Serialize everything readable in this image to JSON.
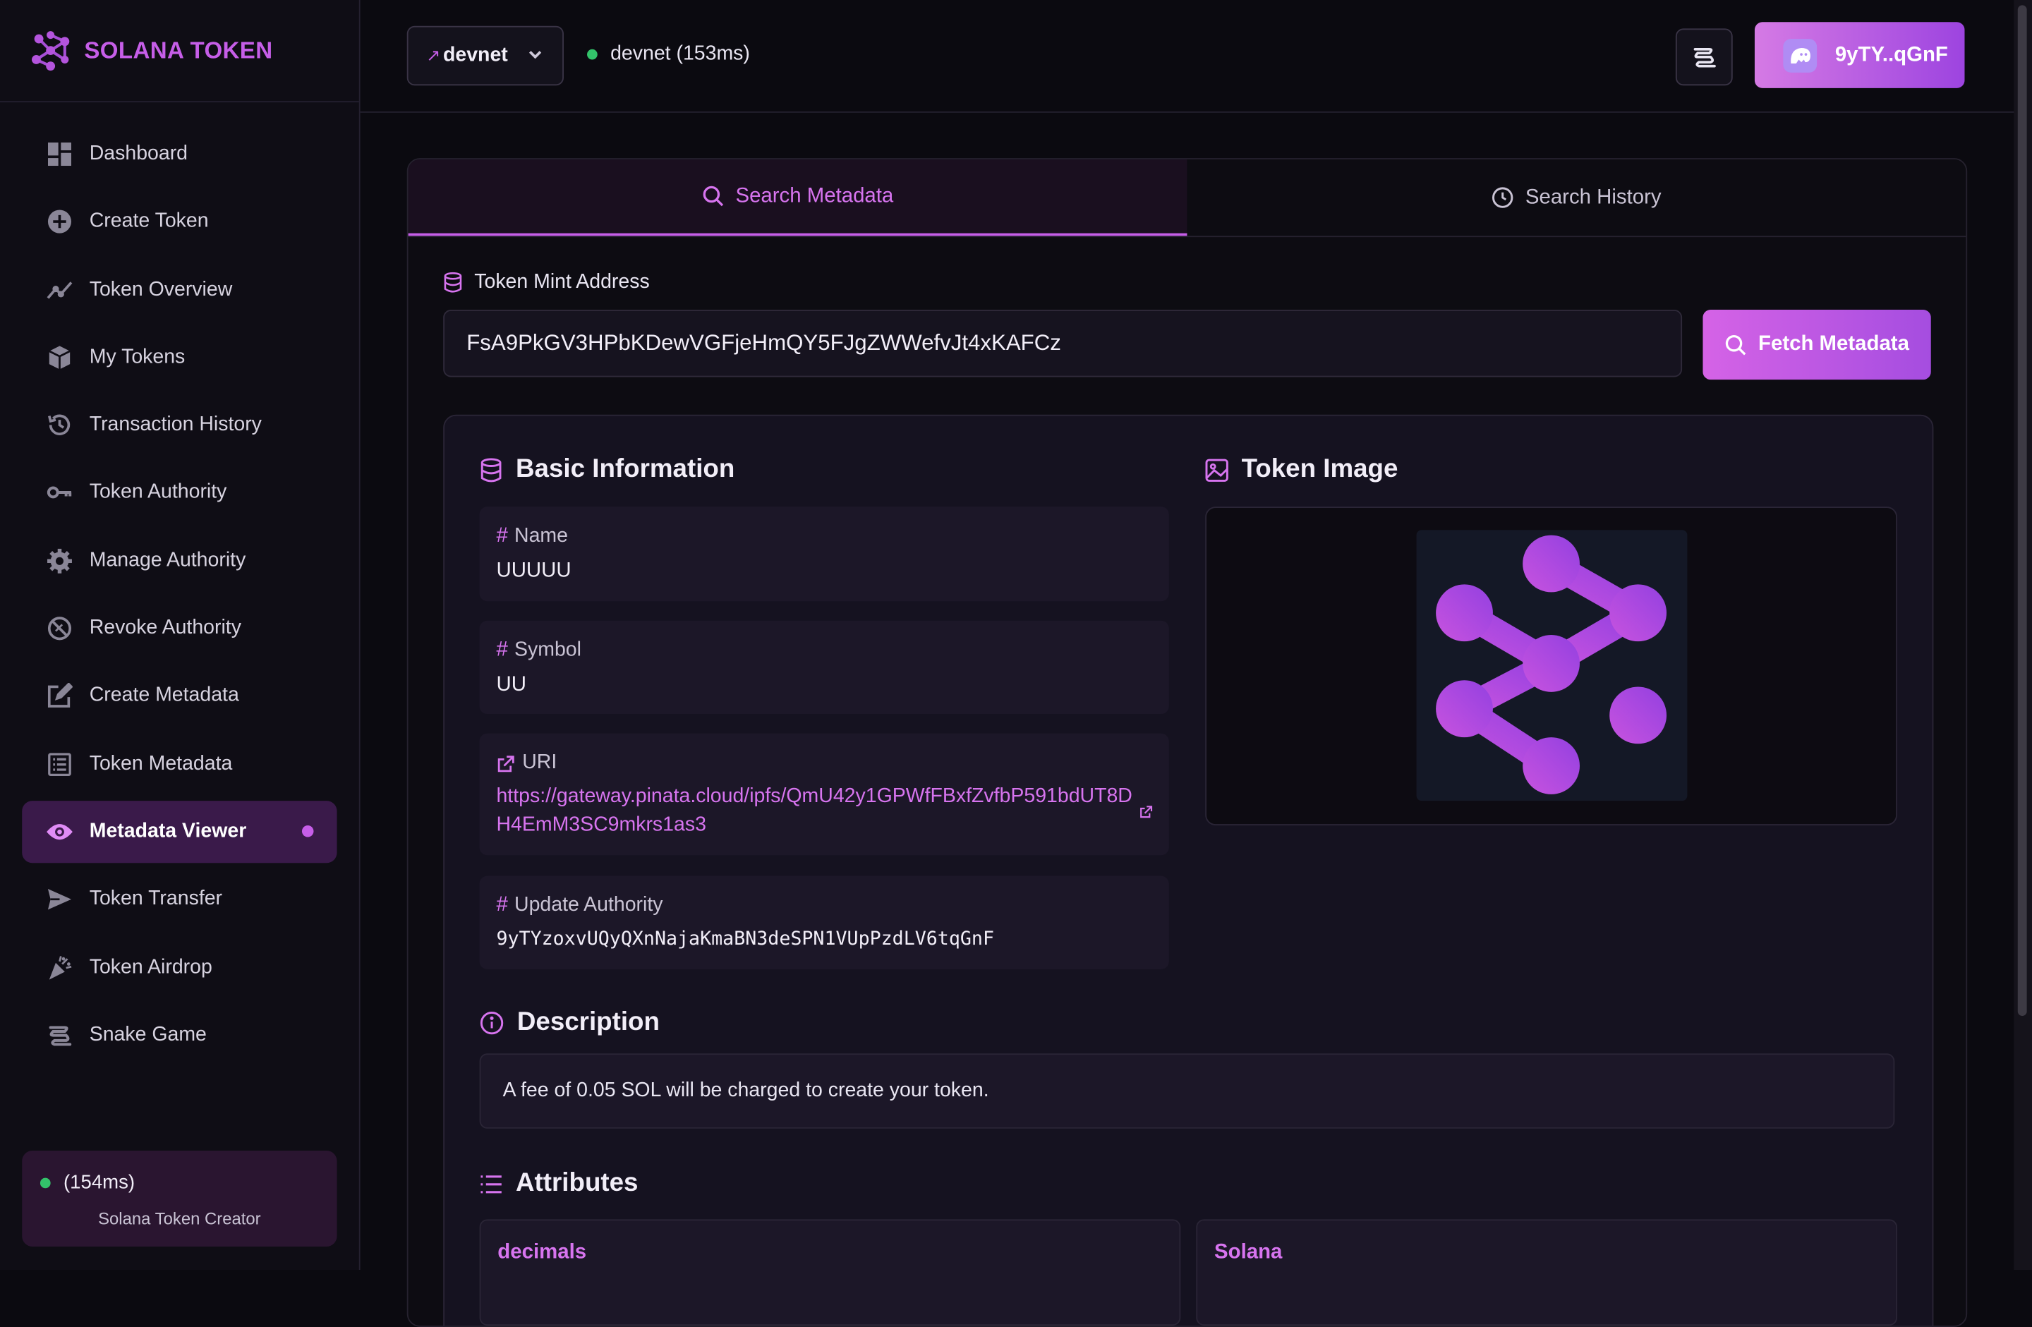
{
  "brand": {
    "name": "SOLANA TOKEN"
  },
  "sidebar": {
    "items": [
      {
        "label": "Dashboard",
        "icon": "dashboard-icon"
      },
      {
        "label": "Create Token",
        "icon": "plus-circle-icon"
      },
      {
        "label": "Token Overview",
        "icon": "trend-chart-icon"
      },
      {
        "label": "My Tokens",
        "icon": "cube-icon"
      },
      {
        "label": "Transaction History",
        "icon": "history-icon"
      },
      {
        "label": "Token Authority",
        "icon": "key-icon"
      },
      {
        "label": "Manage Authority",
        "icon": "gear-icon"
      },
      {
        "label": "Revoke Authority",
        "icon": "block-icon"
      },
      {
        "label": "Create Metadata",
        "icon": "edit-icon"
      },
      {
        "label": "Token Metadata",
        "icon": "list-doc-icon"
      },
      {
        "label": "Metadata Viewer",
        "icon": "eye-icon",
        "active": true
      },
      {
        "label": "Token Transfer",
        "icon": "send-icon"
      },
      {
        "label": "Token Airdrop",
        "icon": "party-icon"
      },
      {
        "label": "Snake Game",
        "icon": "snake-icon"
      }
    ],
    "footer": {
      "latency": "(154ms)",
      "caption": "Solana Token Creator"
    }
  },
  "topbar": {
    "network_select": "devnet",
    "network_status": "devnet (153ms)",
    "wallet": "9yTY..qGnF"
  },
  "tabs": [
    {
      "label": "Search Metadata",
      "active": true
    },
    {
      "label": "Search History",
      "active": false
    }
  ],
  "search": {
    "label": "Token Mint Address",
    "value": "FsA9PkGV3HPbKDewVGFjeHmQY5FJgZWWefvJt4xKAFCz",
    "button": "Fetch Metadata"
  },
  "metadata": {
    "basic_title": "Basic Information",
    "image_title": "Token Image",
    "name_label": "Name",
    "name": "UUUUU",
    "symbol_label": "Symbol",
    "symbol": "UU",
    "uri_label": "URI",
    "uri": "https://gateway.pinata.cloud/ipfs/QmU42y1GPWfFBxfZvfbP591bdUT8DH4EmM3SC9mkrs1as3",
    "authority_label": "Update Authority",
    "authority": "9yTYzoxvUQyQXnNajaKmaBN3deSPN1VUpPzdLV6tqGnF",
    "description_title": "Description",
    "description": "A fee of 0.05 SOL will be charged to create your token.",
    "attributes_title": "Attributes",
    "attributes": [
      "decimals",
      "Solana"
    ]
  },
  "colors": {
    "accent": "#c65ee8",
    "background": "#0b0a10",
    "status_green": "#33c36a"
  }
}
